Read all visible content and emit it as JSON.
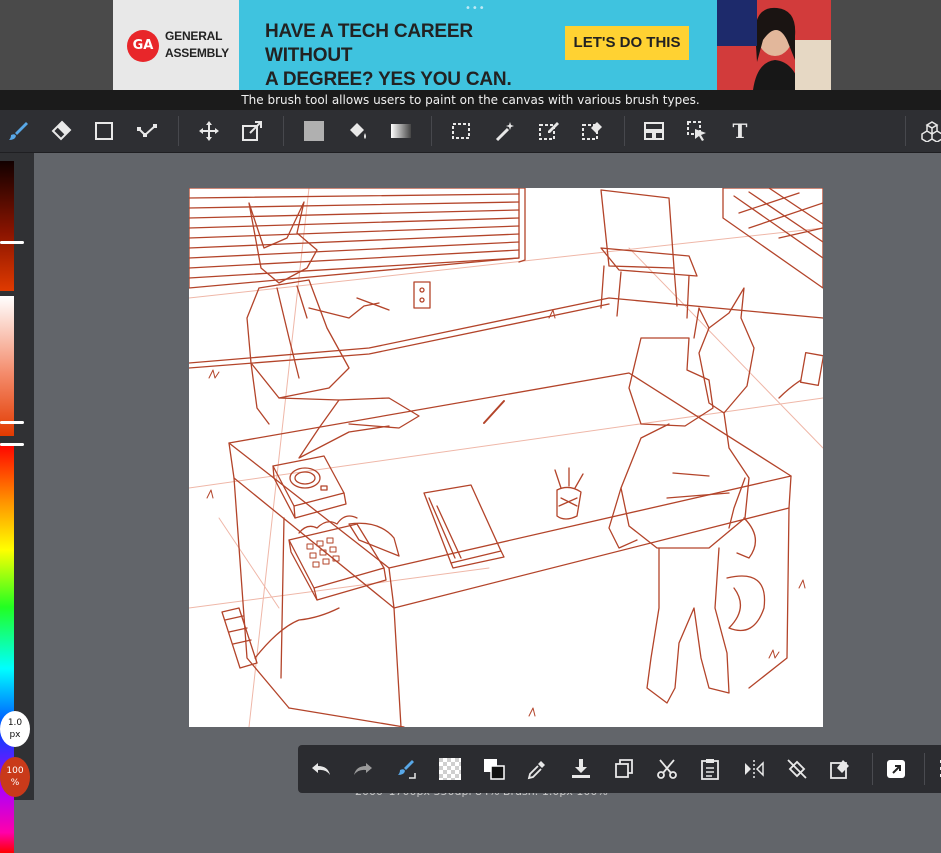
{
  "ad": {
    "logo_mark": "GA",
    "logo_line1": "GENERAL",
    "logo_line2": "ASSEMBLY",
    "headline_line1": "HAVE A TECH CAREER WITHOUT",
    "headline_line2": "A DEGREE? YES YOU CAN.",
    "cta": "LET'S DO THIS",
    "dots": "•••",
    "close_icons": "▷✕"
  },
  "status": {
    "tooltip": "The brush tool allows users to paint on the canvas with various brush types."
  },
  "toolbar": {
    "tools": [
      {
        "name": "brush-tool",
        "icon": "brush-icon"
      },
      {
        "name": "eraser-tool",
        "icon": "eraser-icon"
      },
      {
        "name": "shape-tool",
        "icon": "rectangle-icon"
      },
      {
        "name": "pen-tool",
        "icon": "polyline-icon"
      },
      {
        "name": "move-tool",
        "icon": "move-icon"
      },
      {
        "name": "transform-tool",
        "icon": "transform-icon"
      },
      {
        "name": "fill-rect-tool",
        "icon": "fill-rect-icon"
      },
      {
        "name": "bucket-tool",
        "icon": "bucket-icon"
      },
      {
        "name": "gradient-tool",
        "icon": "gradient-icon"
      },
      {
        "name": "marquee-tool",
        "icon": "marquee-icon"
      },
      {
        "name": "magic-wand-tool",
        "icon": "magic-wand-icon"
      },
      {
        "name": "select-pen-tool",
        "icon": "select-pen-icon"
      },
      {
        "name": "select-eraser-tool",
        "icon": "select-eraser-icon"
      },
      {
        "name": "frame-tool",
        "icon": "frame-icon"
      },
      {
        "name": "operation-tool",
        "icon": "cursor-icon"
      },
      {
        "name": "text-tool",
        "icon": "text-icon",
        "label": "T"
      },
      {
        "name": "3d-tool",
        "icon": "cubes-icon"
      }
    ]
  },
  "palette": {
    "brush_size_line1": "1.0",
    "brush_size_line2": "px",
    "opacity_line1": "100",
    "opacity_line2": "%",
    "colors": {
      "dark": "#8a1400",
      "accent": "#e03a00"
    }
  },
  "info": {
    "text": "2000*1700px 350dpi 84% Brush: 1.0px 100%"
  },
  "bottom_toolbar": {
    "buttons": [
      {
        "name": "undo-button",
        "icon": "undo-icon"
      },
      {
        "name": "redo-button",
        "icon": "redo-icon"
      },
      {
        "name": "brush-swap-button",
        "icon": "brush-swap-icon"
      },
      {
        "name": "transparent-button",
        "icon": "checker-icon"
      },
      {
        "name": "color-swap-button",
        "icon": "color-swap-icon"
      },
      {
        "name": "eyedropper-button",
        "icon": "eyedropper-icon"
      },
      {
        "name": "fill-down-button",
        "icon": "download-icon"
      },
      {
        "name": "copy-button",
        "icon": "copy-icon"
      },
      {
        "name": "cut-button",
        "icon": "scissors-icon"
      },
      {
        "name": "paste-button",
        "icon": "paste-icon"
      },
      {
        "name": "flip-button",
        "icon": "flip-icon"
      },
      {
        "name": "rotate-button",
        "icon": "rotate-icon"
      },
      {
        "name": "clear-button",
        "icon": "clear-icon"
      },
      {
        "name": "share-button",
        "icon": "share-icon"
      },
      {
        "name": "more-button",
        "icon": "more-icon"
      }
    ]
  }
}
